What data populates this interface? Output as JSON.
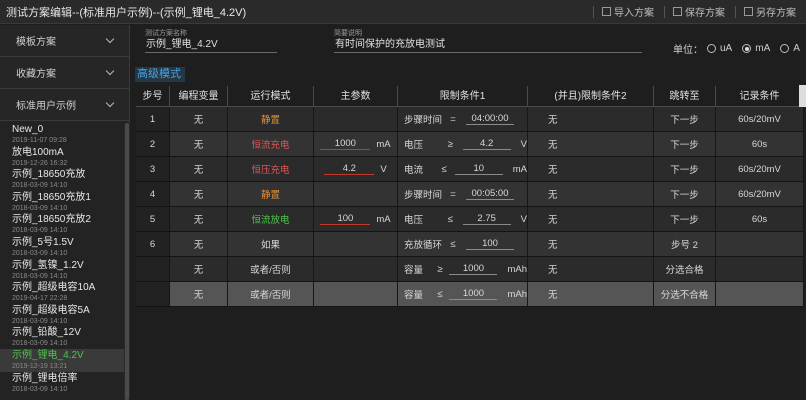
{
  "window": {
    "title": "测试方案编辑--(标准用户示例)--(示例_锂电_4.2V)",
    "import_label": "导入方案",
    "save_label": "保存方案",
    "save_as_label": "另存方案"
  },
  "sidebar": {
    "sections": [
      {
        "label": "模板方案"
      },
      {
        "label": "收藏方案"
      },
      {
        "label": "标准用户示例"
      }
    ],
    "items": [
      {
        "name": "New_0",
        "date": "2019-11-07 09:28"
      },
      {
        "name": "放电100mA",
        "date": "2019-12-26 16:32"
      },
      {
        "name": "示例_18650充放",
        "date": "2018-03-09 14:10"
      },
      {
        "name": "示例_18650充放1",
        "date": "2018-03-09 14:10"
      },
      {
        "name": "示例_18650充放2",
        "date": "2018-03-09 14:10"
      },
      {
        "name": "示例_5号1.5V",
        "date": "2018-03-09 14:10"
      },
      {
        "name": "示例_氢镍_1.2V",
        "date": "2018-03-09 14:10"
      },
      {
        "name": "示例_超级电容10A",
        "date": "2019-04-17 22:28"
      },
      {
        "name": "示例_超级电容5A",
        "date": "2018-03-09 14:10"
      },
      {
        "name": "示例_铅酸_12V",
        "date": "2018-03-09 14:10"
      },
      {
        "name": "示例_锂电_4.2V",
        "date": "2019-12-19 13:21",
        "active": true
      },
      {
        "name": "示例_锂电倍率",
        "date": "2018-03-09 14:10"
      }
    ]
  },
  "form": {
    "name_label": "测试方案名称",
    "name_value": "示例_锂电_4.2V",
    "desc_label": "简要说明",
    "desc_value": "有时间保护的充放电测试",
    "unit_label": "单位：",
    "unit_options": [
      "uA",
      "mA",
      "A"
    ],
    "unit_selected": "mA",
    "advanced_label": "高级模式"
  },
  "table": {
    "headers": [
      "步号",
      "编程变量",
      "运行模式",
      "主参数",
      "限制条件1",
      "(并且)限制条件2",
      "跳转至",
      "记录条件"
    ],
    "rows": [
      {
        "step": "1",
        "var": "无",
        "mode": "静置",
        "mode_color": "orange",
        "param_value": "",
        "param_unit": "",
        "lim1_name": "步骤时间",
        "lim1_op": "=",
        "lim1_value": "04:00:00",
        "lim1_unit": "",
        "lim2": "无",
        "jump": "下一步",
        "record": "60s/20mV"
      },
      {
        "step": "2",
        "var": "无",
        "mode": "恒流充电",
        "mode_color": "red",
        "param_value": "1000",
        "param_unit": "mA",
        "lim1_name": "电压",
        "lim1_op": "≥",
        "lim1_value": "4.2",
        "lim1_unit": "V",
        "lim2": "无",
        "jump": "下一步",
        "record": "60s"
      },
      {
        "step": "3",
        "var": "无",
        "mode": "恒压充电",
        "mode_color": "red",
        "param_value": "4.2",
        "param_unit": "V",
        "lim1_name": "电流",
        "lim1_op": "≤",
        "lim1_value": "10",
        "lim1_unit": "mA",
        "lim2": "无",
        "jump": "下一步",
        "record": "60s/20mV"
      },
      {
        "step": "4",
        "var": "无",
        "mode": "静置",
        "mode_color": "orange",
        "param_value": "",
        "param_unit": "",
        "lim1_name": "步骤时间",
        "lim1_op": "=",
        "lim1_value": "00:05:00",
        "lim1_unit": "",
        "lim2": "无",
        "jump": "下一步",
        "record": "60s/20mV"
      },
      {
        "step": "5",
        "var": "无",
        "mode": "恒流放电",
        "mode_color": "green",
        "param_value": "100",
        "param_unit": "mA",
        "lim1_name": "电压",
        "lim1_op": "≤",
        "lim1_value": "2.75",
        "lim1_unit": "V",
        "lim2": "无",
        "jump": "下一步",
        "record": "60s"
      },
      {
        "step": "6",
        "var": "无",
        "mode": "如果",
        "mode_color": "",
        "param_value": "",
        "param_unit": "",
        "lim1_name": "充放循环",
        "lim1_op": "≤",
        "lim1_value": "100",
        "lim1_unit": "",
        "lim2": "无",
        "jump": "步号 2",
        "record": ""
      },
      {
        "step": "",
        "var": "无",
        "mode": "或者/否则",
        "mode_color": "",
        "param_value": "",
        "param_unit": "",
        "lim1_name": "容量",
        "lim1_op": "≥",
        "lim1_value": "1000",
        "lim1_unit": "mAh",
        "lim2": "无",
        "jump": "分选合格",
        "record": ""
      },
      {
        "step": "",
        "var": "无",
        "mode": "或者/否则",
        "mode_color": "",
        "param_value": "",
        "param_unit": "",
        "lim1_name": "容量",
        "lim1_op": "≤",
        "lim1_value": "1000",
        "lim1_unit": "mAh",
        "lim2": "无",
        "jump": "分选不合格",
        "record": ""
      }
    ]
  }
}
